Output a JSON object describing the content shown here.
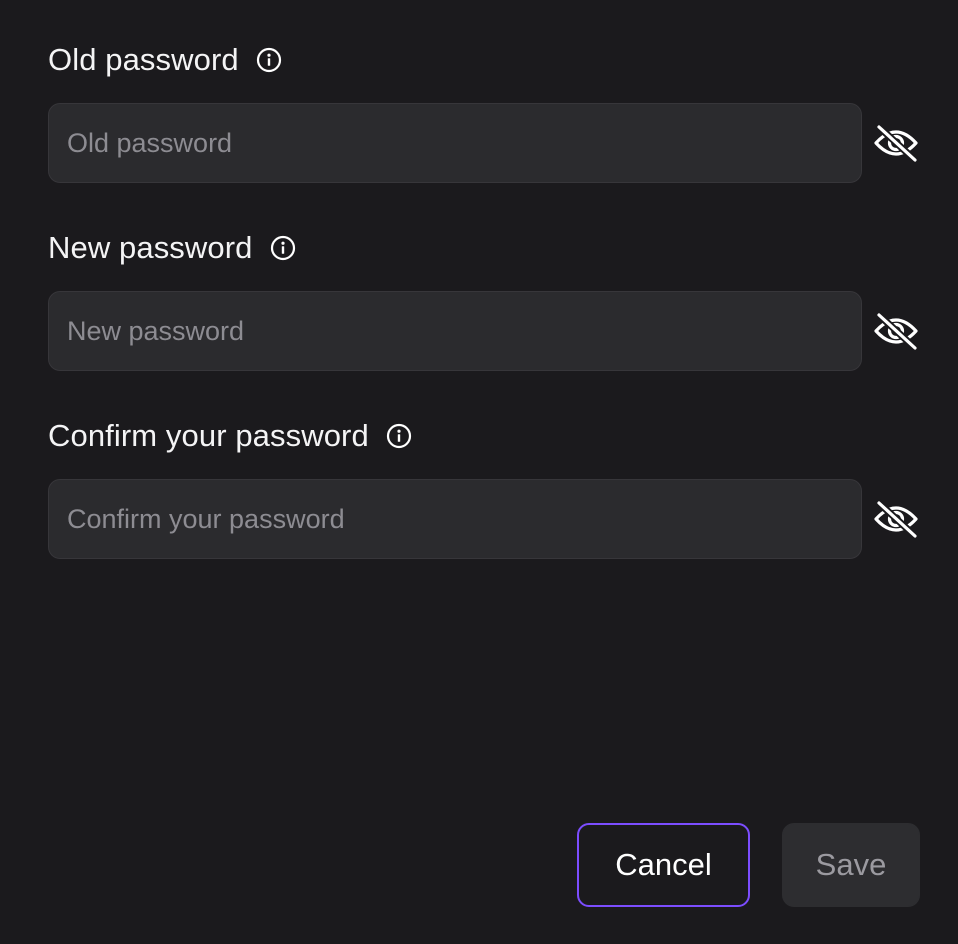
{
  "fields": [
    {
      "label": "Old password",
      "placeholder": "Old password",
      "value": ""
    },
    {
      "label": "New password",
      "placeholder": "New password",
      "value": ""
    },
    {
      "label": "Confirm your password",
      "placeholder": "Confirm your password",
      "value": ""
    }
  ],
  "icons": {
    "info": "info-icon",
    "toggle_visibility": "eye-off-icon"
  },
  "actions": {
    "cancel_label": "Cancel",
    "save_label": "Save"
  },
  "colors": {
    "background": "#1b1a1d",
    "input_background": "#2b2b2e",
    "accent": "#7c4dff",
    "label_text": "#f4f4f5",
    "placeholder_text": "#8d8c92",
    "disabled_button_text": "#9b9aa0"
  }
}
